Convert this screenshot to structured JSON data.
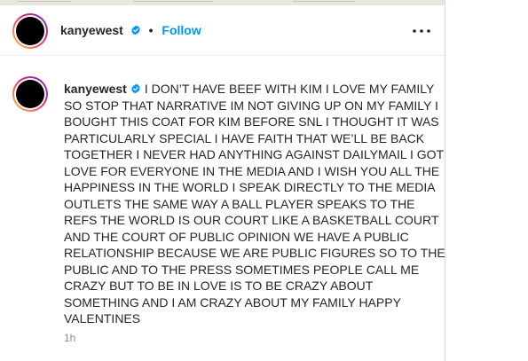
{
  "header": {
    "username": "kanyewest",
    "separator": "•",
    "follow_label": "Follow",
    "more_icon": "more-horizontal-icon"
  },
  "caption": {
    "username": "kanyewest",
    "lines": [
      "I DON’T HAVE BEEF WITH KIM I LOVE MY FAMILY",
      "SO STOP THAT NARRATIVE IM NOT GIVING UP ON MY FAMILY I",
      "BOUGHT THIS COAT FOR KIM BEFORE SNL I THOUGHT IT WAS",
      "PARTICULARLY SPECIAL I HAVE FAITH THAT WE’LL BE BACK",
      "TOGETHER I NEVER HAD ANYTHING AGAINST DAILYMAIL I GOT",
      "LOVE FOR EVERYONE IN THE MEDIA AND I WISH YOU ALL THE",
      "HAPPINESS IN THE WORLD I SPEAK DIRECTLY TO THE MEDIA",
      "OUTLETS THE SAME WAY A BALL PLAYER SPEAKS TO THE",
      "REFS THE WORLD IS OUR COURT LIKE A BASKETBALL COURT",
      "AND THE COURT OF PUBLIC OPINION WE HAVE A PUBLIC",
      "RELATIONSHIP BECAUSE WE ARE PUBLIC FIGURES SO TO THE",
      "PUBLIC AND TO THE PRESS SOMETIMES PEOPLE CALL ME",
      "CRAZY BUT TO BE IN LOVE IS TO BE CRAZY ABOUT",
      "SOMETHING AND I AM CRAZY ABOUT MY FAMILY HAPPY",
      "VALENTINES"
    ],
    "timestamp": "1h"
  },
  "colors": {
    "link_blue": "#0095f6",
    "verified_blue": "#0095f6",
    "muted_gray": "#8e8e8e"
  }
}
